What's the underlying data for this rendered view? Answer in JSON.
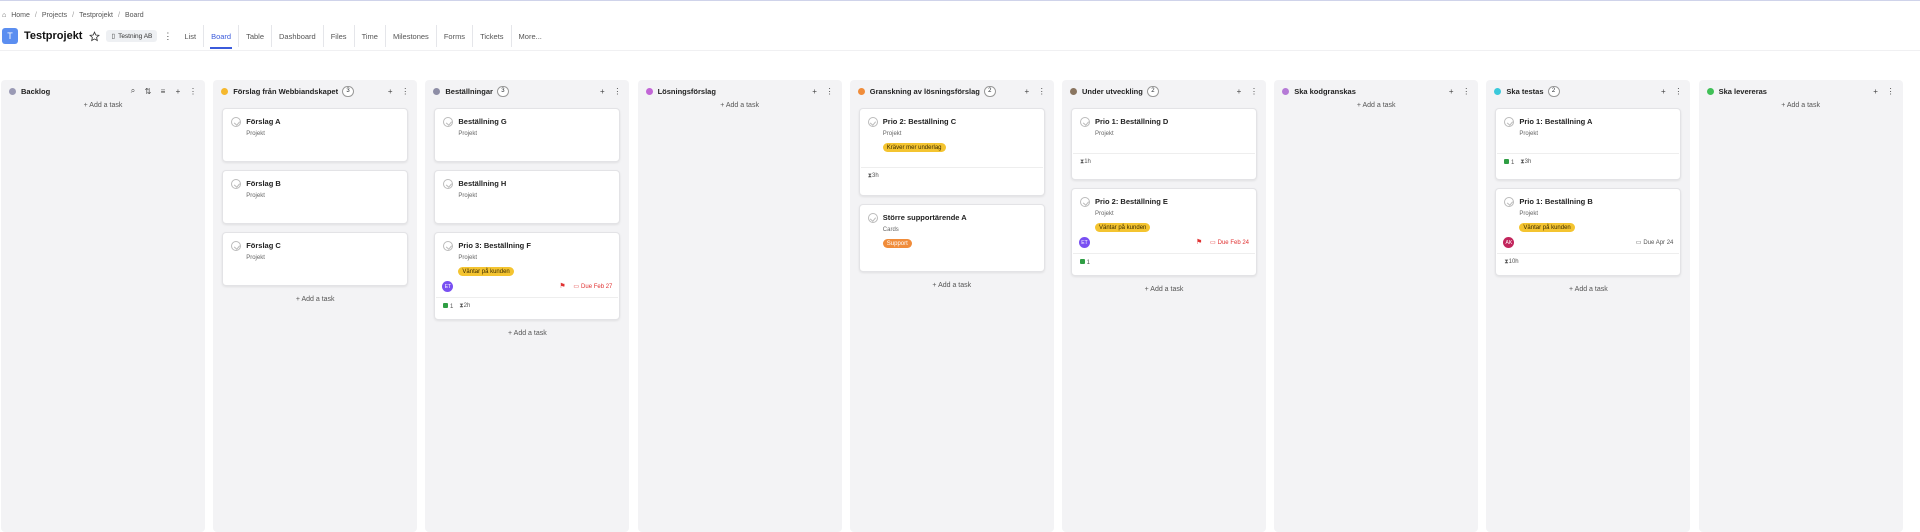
{
  "breadcrumb": {
    "items": [
      "Home",
      "Projects",
      "Testprojekt",
      "Board"
    ],
    "sep": "/"
  },
  "project": {
    "avatar": "T",
    "name": "Testprojekt",
    "company": "Testning AB"
  },
  "tabs": [
    "List",
    "Board",
    "Table",
    "Dashboard",
    "Files",
    "Time",
    "Milestones",
    "Forms",
    "Tickets",
    "More..."
  ],
  "active_tab": "Board",
  "add_task": "+ Add a task",
  "colors": {
    "accent": "#3b5bdb",
    "label_yellow": "#f4c430",
    "label_orange": "#f08c3a",
    "due_red": "#e03131"
  },
  "columns": [
    {
      "name": "Backlog",
      "color": "#9a9ab5",
      "count": "",
      "icons": [
        "search-icon",
        "sort-icon",
        "filter-icon",
        "plus-icon",
        "more-icon"
      ],
      "cards": []
    },
    {
      "name": "Förslag från Webbiandskapet",
      "color": "#f5b82e",
      "count": "3",
      "icons": [
        "plus-icon",
        "more-icon"
      ],
      "cards": [
        {
          "title": "Förslag A",
          "sub": "Projekt"
        },
        {
          "title": "Förslag B",
          "sub": "Projekt"
        },
        {
          "title": "Förslag C",
          "sub": "Projekt"
        }
      ]
    },
    {
      "name": "Beställningar",
      "color": "#8e8ea6",
      "count": "3",
      "icons": [
        "plus-icon",
        "more-icon"
      ],
      "cards": [
        {
          "title": "Beställning G",
          "sub": "Projekt"
        },
        {
          "title": "Beställning H",
          "sub": "Projekt"
        },
        {
          "title": "Prio 3: Beställning F",
          "sub": "Projekt",
          "label": "Väntar på kunden",
          "avatar": "ET",
          "due": "Due Feb 27",
          "comments": "1",
          "time": "2h"
        }
      ]
    },
    {
      "name": "Lösningsförslag",
      "color": "#c266d6",
      "count": "",
      "icons": [
        "plus-icon",
        "more-icon"
      ],
      "cards": []
    },
    {
      "name": "Granskning av lösningsförslag",
      "color": "#f08c3a",
      "count": "2",
      "icons": [
        "plus-icon",
        "more-icon"
      ],
      "cards": [
        {
          "title": "Prio 2: Beställning C",
          "sub": "Projekt",
          "label": "Kräver mer underlag",
          "time": "3h"
        },
        {
          "title": "Större supportärende A",
          "sub": "Cards",
          "label": "Support"
        }
      ]
    },
    {
      "name": "Under utveckling",
      "color": "#8a7560",
      "count": "2",
      "icons": [
        "plus-icon",
        "more-icon"
      ],
      "cards": [
        {
          "title": "Prio 1: Beställning D",
          "sub": "Projekt",
          "time": "1h"
        },
        {
          "title": "Prio 2: Beställning E",
          "sub": "Projekt",
          "label": "Väntar på kunden",
          "avatar": "ET",
          "due": "Due Feb 24",
          "comments": "1"
        }
      ]
    },
    {
      "name": "Ska kodgranskas",
      "color": "#b57ad6",
      "count": "",
      "icons": [
        "plus-icon",
        "more-icon"
      ],
      "cards": []
    },
    {
      "name": "Ska testas",
      "color": "#3bc9db",
      "count": "2",
      "icons": [
        "plus-icon",
        "more-icon"
      ],
      "cards": [
        {
          "title": "Prio 1: Beställning A",
          "sub": "Projekt",
          "comments": "1",
          "time": "3h"
        },
        {
          "title": "Prio 1: Beställning B",
          "sub": "Projekt",
          "label": "Väntar på kunden",
          "avatar": "AK",
          "due": "Due Apr 24",
          "time": "10h"
        }
      ]
    },
    {
      "name": "Ska levereras",
      "color": "#40c057",
      "count": "",
      "icons": [
        "plus-icon",
        "more-icon"
      ],
      "cards": []
    }
  ]
}
